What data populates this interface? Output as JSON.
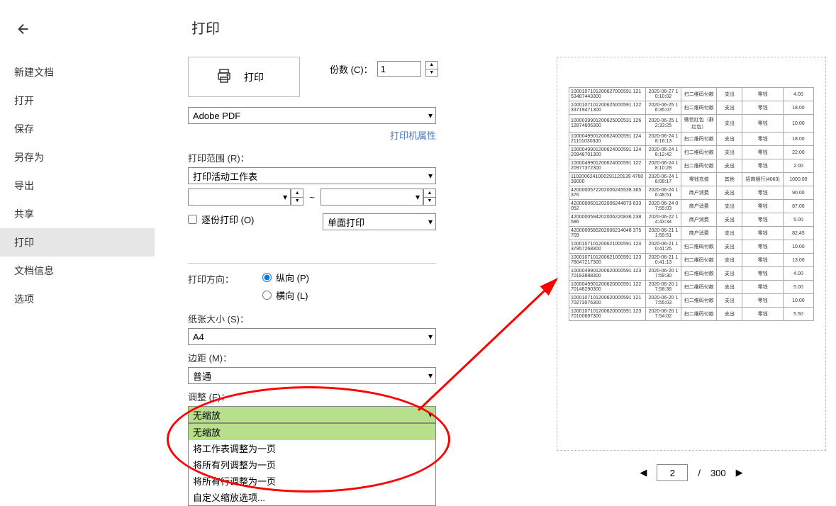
{
  "title": "打印",
  "sidebar": {
    "items": [
      {
        "label": "新建文档"
      },
      {
        "label": "打开"
      },
      {
        "label": "保存"
      },
      {
        "label": "另存为"
      },
      {
        "label": "导出"
      },
      {
        "label": "共享"
      },
      {
        "label": "打印"
      },
      {
        "label": "文档信息"
      },
      {
        "label": "选项"
      }
    ],
    "activeIndex": 6
  },
  "copies": {
    "label": "份数 (C)：",
    "value": "1"
  },
  "printBtn": {
    "label": "打印"
  },
  "printer": {
    "selected": "Adobe PDF",
    "propsLink": "打印机属性"
  },
  "printRange": {
    "label": "打印范围 (R)：",
    "selected": "打印活动工作表",
    "from": "",
    "to": "",
    "sep": "~"
  },
  "collate": {
    "label": "逐份打印 (O)",
    "checked": false
  },
  "duplex": {
    "selected": "单面打印"
  },
  "orientation": {
    "label": "打印方向：",
    "portrait": "纵向 (P)",
    "landscape": "横向 (L)",
    "value": "portrait"
  },
  "paper": {
    "label": "纸张大小 (S)：",
    "selected": "A4"
  },
  "margin": {
    "label": "边距 (M)：",
    "selected": "普通"
  },
  "scaling": {
    "label": "调整 (F)：",
    "selected": "无缩放",
    "options": [
      "无缩放",
      "将工作表调整为一页",
      "将所有列调整为一页",
      "将所有行调整为一页",
      "自定义缩放选项..."
    ],
    "highlight": 0
  },
  "preview": {
    "rows": [
      [
        "1000107101200627000591\n12153487443300",
        "2020-06-27\n10:10:02",
        "扫二维码付款",
        "支出",
        "零钱",
        "4.00"
      ],
      [
        "1000107101200625000591\n12233719471300",
        "2020-06-25\n16:35:07",
        "扫二维码付款",
        "支出",
        "零钱",
        "18.00"
      ],
      [
        "1000039901200625000531\n12612874606300",
        "2020-06-25\n12:33:25",
        "微信红包（群红包）",
        "支出",
        "零钱",
        "10.00"
      ],
      [
        "1000049901200624000591\n12421101030300",
        "2020-06-24\n18:16:13",
        "扫二维码付款",
        "支出",
        "零钱",
        "18.00"
      ],
      [
        "1000049901200624000591\n12420948701300",
        "2020-06-24\n18:12:42",
        "扫二维码付款",
        "支出",
        "零钱",
        "22.00"
      ],
      [
        "1000049901200624000591\n12220977372300",
        "2020-06-24\n18:10:28",
        "扫二维码付款",
        "支出",
        "零钱",
        "2.00"
      ],
      [
        "1102006241000291120139\n476039000",
        "2020-06-24\n18:08:17",
        "零钱充值",
        "其他",
        "招商银行(4063)",
        "1000.00"
      ],
      [
        "4200000572202006245538\n365376",
        "2020-06-24\n16:48:51",
        "商户消费",
        "支出",
        "零钱",
        "90.00"
      ],
      [
        "4200000601202006244873\n633052",
        "2020-06-24\n07:55:03",
        "商户消费",
        "支出",
        "零钱",
        "87.00"
      ],
      [
        "4200000594202006220836\n238586",
        "2020-06-22\n14:43:34",
        "商户消费",
        "支出",
        "零钱",
        "5.00"
      ],
      [
        "4200000585202006214048\n375709",
        "2020-06-21\n11:59:51",
        "商户消费",
        "支出",
        "零钱",
        "82.45"
      ],
      [
        "1000107101200621000591\n12437957268300",
        "2020-06-21\n10:41:25",
        "扫二维码付款",
        "支出",
        "零钱",
        "10.00"
      ],
      [
        "1000107101200621000591\n12378047217300",
        "2020-06-21\n10:41:13",
        "扫二维码付款",
        "支出",
        "零钱",
        "13.00"
      ],
      [
        "1000049901200620000591\n12370193888300",
        "2020-06-20\n17:59:30",
        "扫二维码付款",
        "支出",
        "零钱",
        "4.00"
      ],
      [
        "1000049901200620000591\n12270148290300",
        "2020-06-20\n17:58:36",
        "扫二维码付款",
        "支出",
        "零钱",
        "5.00"
      ],
      [
        "1000107101200620000591\n12170273076300",
        "2020-06-20\n17:55:03",
        "扫二维码付款",
        "支出",
        "零钱",
        "10.00"
      ],
      [
        "1000107101200620000591\n12370100697300",
        "2020-06-20\n17:54:02",
        "扫二维码付款",
        "支出",
        "零钱",
        "5.50"
      ]
    ]
  },
  "pager": {
    "current": "2",
    "sep": "/",
    "total": "300"
  }
}
